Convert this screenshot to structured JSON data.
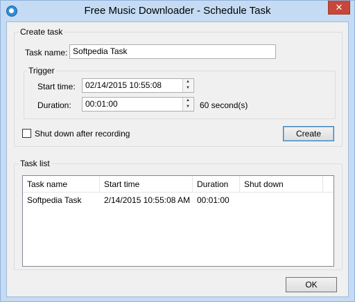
{
  "window": {
    "title": "Free Music Downloader - Schedule Task",
    "close_glyph": "✕"
  },
  "create_task": {
    "group_label": "Create task",
    "task_name_label": "Task name:",
    "task_name_value": "Softpedia Task",
    "trigger": {
      "group_label": "Trigger",
      "start_time_label": "Start time:",
      "start_time_value": "02/14/2015 10:55:08",
      "duration_label": "Duration:",
      "duration_value": "00:01:00",
      "duration_note": "60 second(s)"
    },
    "shutdown_label": "Shut down after recording",
    "shutdown_checked": false,
    "create_button": "Create"
  },
  "task_list": {
    "group_label": "Task list",
    "columns": [
      "Task name",
      "Start time",
      "Duration",
      "Shut down"
    ],
    "rows": [
      [
        "Softpedia Task",
        "2/14/2015 10:55:08 AM",
        "00:01:00",
        ""
      ]
    ]
  },
  "ok_button": "OK",
  "icons": {
    "app": "app-logo-icon",
    "close": "close-icon",
    "spin_up": "spin-up-icon",
    "spin_down": "spin-down-icon"
  }
}
